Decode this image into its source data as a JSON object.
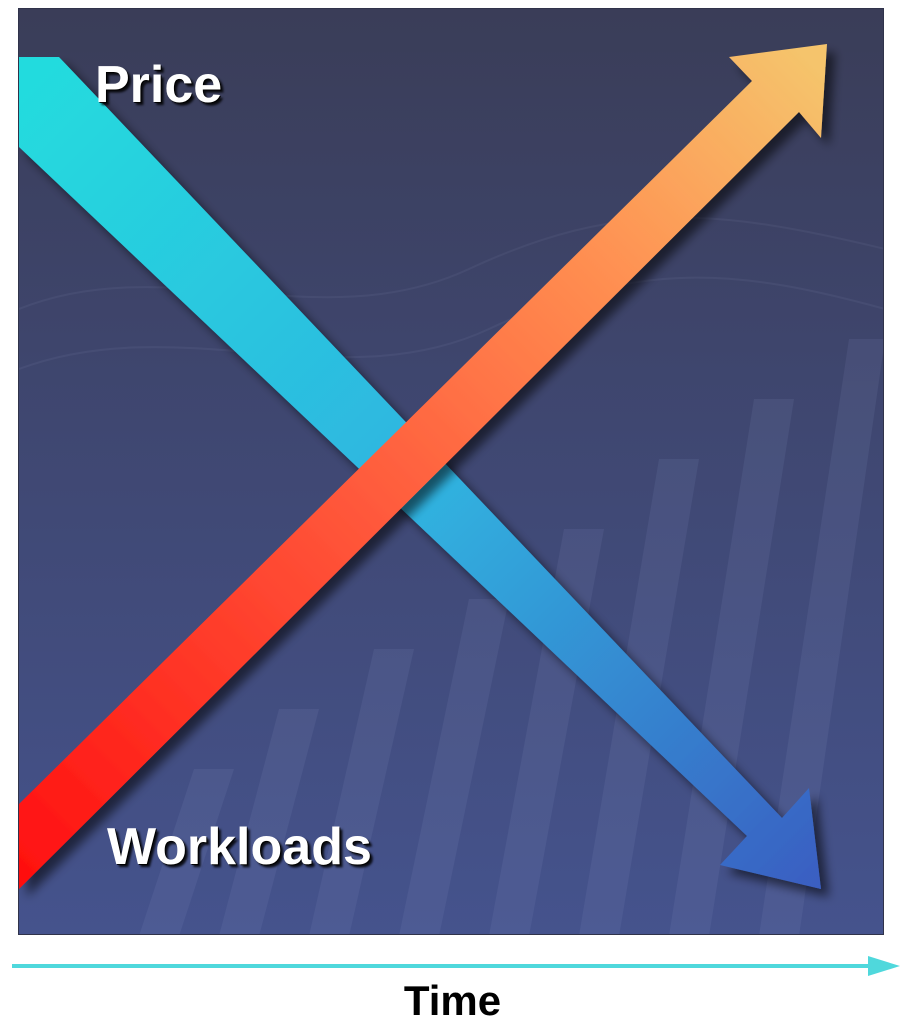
{
  "diagram": {
    "labels": {
      "decreasing": "Price",
      "increasing": "Workloads",
      "axis": "Time"
    },
    "colors": {
      "background_top": "#3b3e5a",
      "background_bottom": "#44528e",
      "decreasing_start": "#25d6dc",
      "decreasing_end": "#3b63c4",
      "increasing_start": "#ff1414",
      "increasing_mid": "#ff7a45",
      "increasing_end": "#f4c46a",
      "axis_arrow": "#4fd8dc"
    },
    "icons": {
      "decreasing_arrow": "down-right-arrow-icon",
      "increasing_arrow": "up-right-arrow-icon",
      "time_arrow": "right-arrow-icon"
    }
  }
}
